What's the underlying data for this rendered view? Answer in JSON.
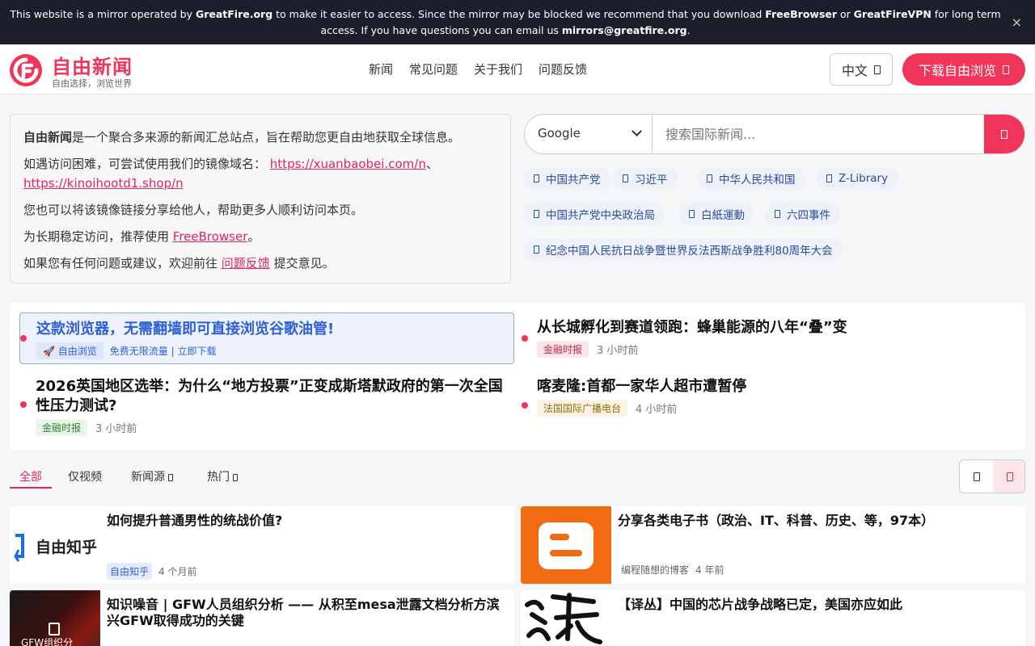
{
  "notice": {
    "text_1": "This website is a mirror operated by ",
    "greatfire": "GreatFire.org",
    "text_2": " to make it easier to access. Since the mirror may be blocked we recommend that you download ",
    "freebrowser": "FreeBrowser",
    "text_3": " or ",
    "greatfirevpn": "GreatFireVPN",
    "text_4": " for long term access. If you have questions you can email us ",
    "email": "mirrors@greatfire.org",
    "text_5": ".",
    "close": "×"
  },
  "header": {
    "brand": "自由新闻",
    "tagline": "自由选择，浏览世界",
    "nav": [
      "新闻",
      "常见问题",
      "关于我们",
      "问题反馈"
    ],
    "lang": "中文",
    "download": "下载自由浏览"
  },
  "intro": {
    "p1_bold": "自由新闻",
    "p1_rest": "是一个聚合多来源的新闻汇总站点，旨在帮助您更自由地获取全球信息。",
    "p2_text": "如遇访问困难，可尝试使用我们的镜像域名：",
    "p2_link1": "https://xuanbaobei.com/n",
    "p2_sep": "、",
    "p2_link2": "https://kinoihootd1.shop/n",
    "p3": "您也可以将该镜像链接分享给他人，帮助更多人顺利访问本页。",
    "p4_text": "为长期稳定访问，推荐使用 ",
    "p4_link": "FreeBrowser",
    "p4_end": "。",
    "p5_text": "如果您有任何问题或建议，欢迎前往 ",
    "p5_link": "问题反馈",
    "p5_end": " 提交意见。"
  },
  "search": {
    "engine": "Google",
    "placeholder": "搜索国际新闻..."
  },
  "tags": [
    "中国共产党",
    "习近平",
    "中华人民共和国",
    "Z-Library",
    "中国共产党中央政治局",
    "白紙運動",
    "六四事件",
    "纪念中国人民抗日战争暨世界反法西斯战争胜利80周年大会"
  ],
  "featured": {
    "ad": {
      "title": "这款浏览器，无需翻墙即可直接浏览谷歌油管!",
      "badge": "🚀 自由浏览",
      "sub": "免费无限流量 | 立即下载"
    },
    "items": [
      {
        "title": "从长城孵化到赛道领跑：蜂巢能源的八年“叠”变",
        "source": "金融时报",
        "time": "3 小时前"
      },
      {
        "title": "2026英国地区选举：为什么“地方投票”正变成斯塔默政府的第一次全国性压力测试?",
        "source": "金融时报",
        "time": "3 小时前"
      },
      {
        "title": "喀麦隆:首都一家华人超市遭暂停",
        "source": "法国国际广播电台",
        "time": "4 小时前"
      }
    ]
  },
  "tabs": [
    "全部",
    "仅视频",
    "新闻源",
    "热门"
  ],
  "cards": [
    {
      "title": "如何提升普通男性的统战价值?",
      "source": "自由知乎",
      "time": "4 个月前",
      "thumb_text": "自由知乎"
    },
    {
      "title": "分享各类电子书（政治、IT、科普、历史、等，97本）",
      "source": "编程随想的博客",
      "time": "4 年前"
    },
    {
      "title": "知识噪音 | GFW人员组织分析 —— 从积至mesa泄露文档分析方滨兴GFW取得成功的关键",
      "thumb_text": "GFW组织分"
    },
    {
      "title": "【译丛】中国的芯片战争战略已定，美国亦应如此"
    }
  ]
}
